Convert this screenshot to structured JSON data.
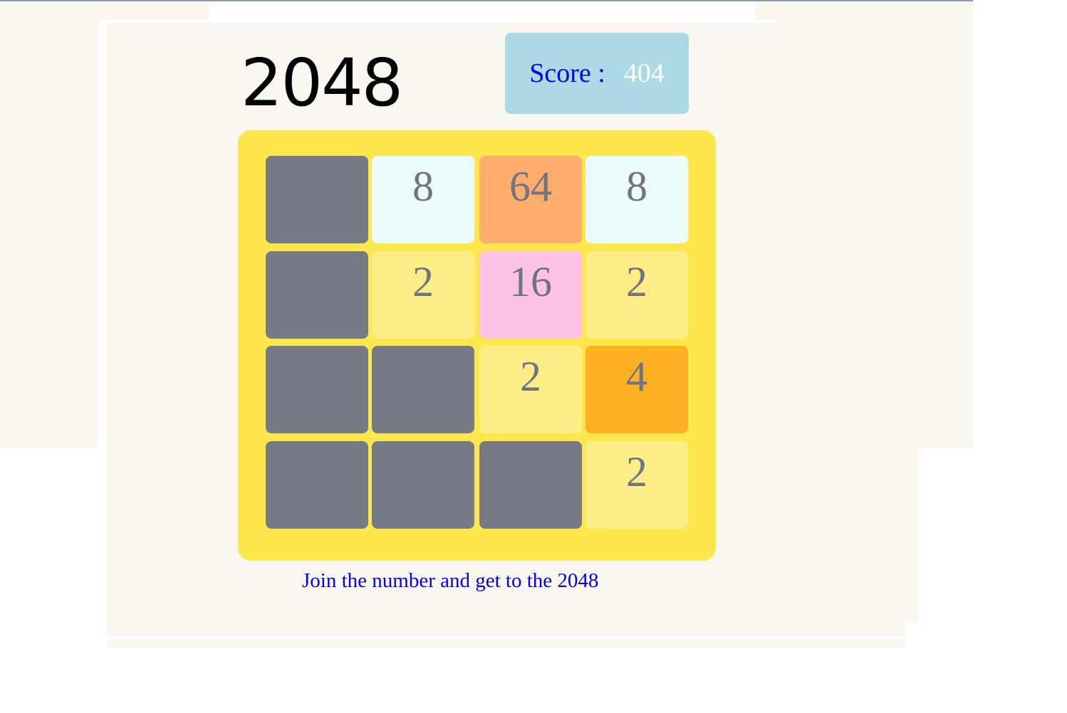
{
  "title": "2048",
  "score": {
    "label": "Score :",
    "value": "404"
  },
  "board": [
    [
      "",
      "8",
      "64",
      "8"
    ],
    [
      "",
      "2",
      "16",
      "2"
    ],
    [
      "",
      "",
      "2",
      "4"
    ],
    [
      "",
      "",
      "",
      "2"
    ]
  ],
  "colors": {
    "": "#757a85",
    "2": "#fded86",
    "4": "#fdb022",
    "8": "#ebfbfb",
    "16": "#fdc2e4",
    "64": "#ffac6c"
  },
  "message": "Join the number and get to the 2048"
}
